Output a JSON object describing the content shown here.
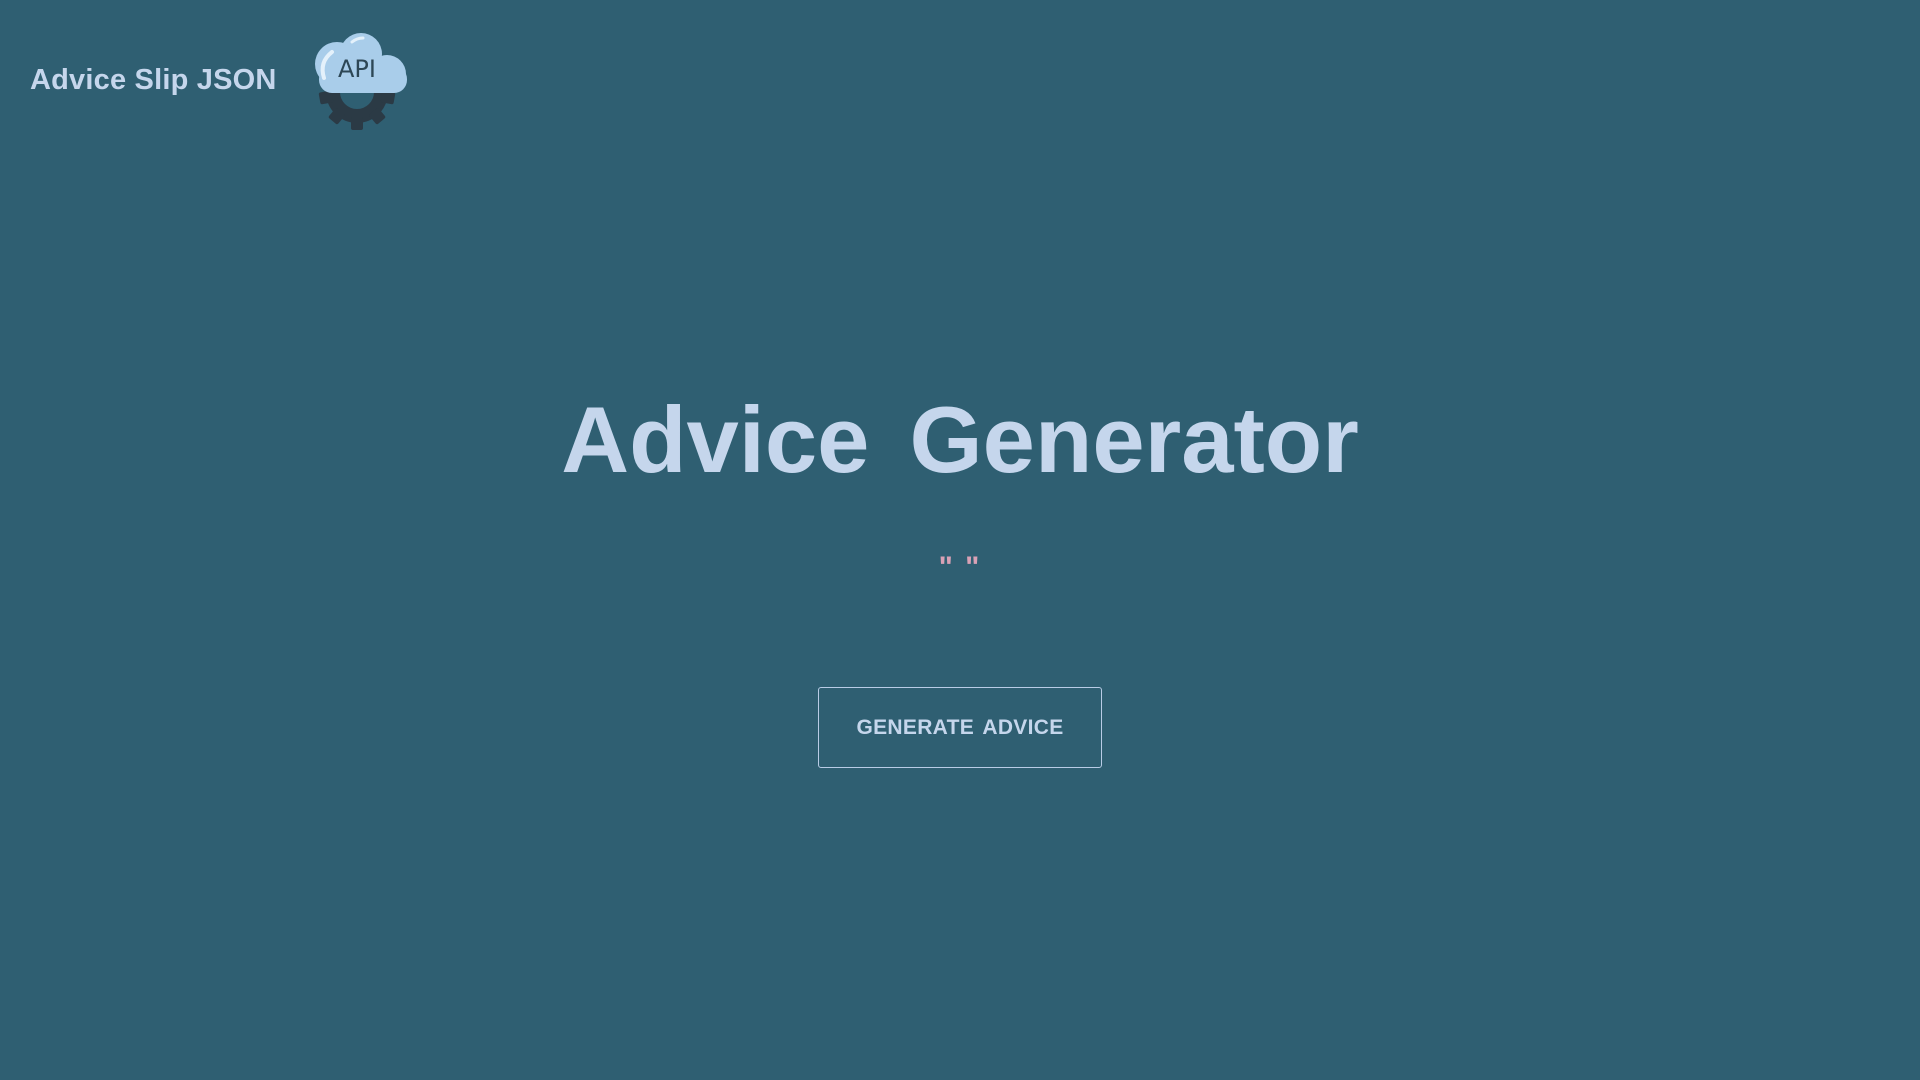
{
  "header": {
    "brand_title": "Advice Slip JSON",
    "logo_text": "API",
    "logo_icon": "api-cloud-gear-icon"
  },
  "main": {
    "title": "Advice Generator",
    "advice_text": "\" \"",
    "generate_button_label": "GENERATE ADVICE"
  },
  "colors": {
    "background": "#2f5f72",
    "text_primary": "#c5d6ec",
    "quote_accent": "#d9a1b5",
    "logo_cloud": "#a9cdea",
    "logo_gear": "#2b3a45"
  }
}
